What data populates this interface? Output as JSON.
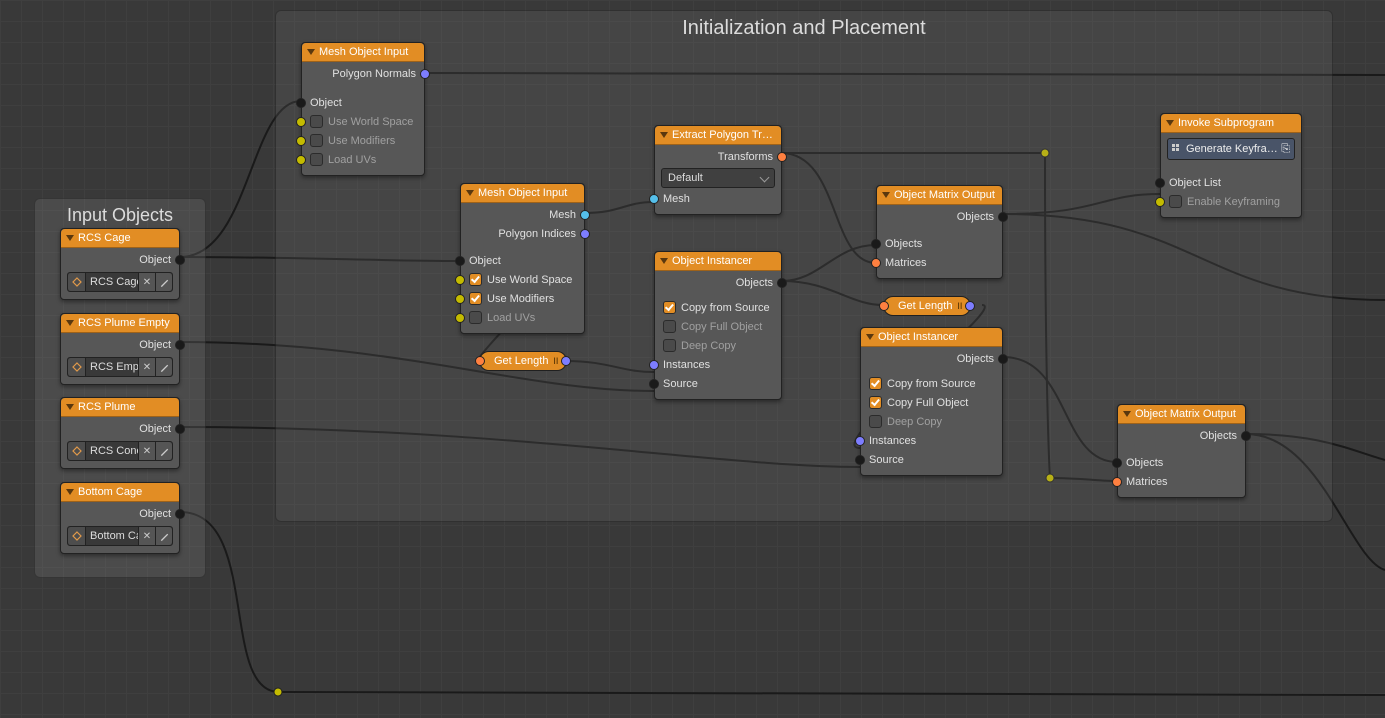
{
  "frames": {
    "input_objects": {
      "title": "Input Objects"
    },
    "main": {
      "title": "Initialization and Placement"
    }
  },
  "nodes": {
    "rcs_cage": {
      "title": "RCS Cage",
      "out": "Object",
      "obj": "RCS Cage"
    },
    "rcs_plume_empty": {
      "title": "RCS Plume Empty",
      "out": "Object",
      "obj": "RCS Empty"
    },
    "rcs_plume": {
      "title": "RCS Plume",
      "out": "Object",
      "obj": "RCS Cone"
    },
    "bottom_cage": {
      "title": "Bottom Cage",
      "out": "Object",
      "obj": "Bottom Ca"
    },
    "mesh_input_1": {
      "title": "Mesh Object Input",
      "out_normals": "Polygon Normals",
      "in_object": "Object",
      "use_world": "Use World Space",
      "use_mods": "Use Modifiers",
      "load_uvs": "Load UVs"
    },
    "mesh_input_2": {
      "title": "Mesh Object Input",
      "out_mesh": "Mesh",
      "out_indices": "Polygon Indices",
      "in_object": "Object",
      "use_world": "Use World Space",
      "use_mods": "Use Modifiers",
      "load_uvs": "Load UVs"
    },
    "extract_poly": {
      "title": "Extract Polygon Tr…",
      "out_transforms": "Transforms",
      "select_val": "Default",
      "in_mesh": "Mesh"
    },
    "instancer_1": {
      "title": "Object Instancer",
      "out_objects": "Objects",
      "copy_from_source": "Copy from Source",
      "copy_full": "Copy Full Object",
      "deep_copy": "Deep Copy",
      "in_instances": "Instances",
      "in_source": "Source"
    },
    "instancer_2": {
      "title": "Object Instancer",
      "out_objects": "Objects",
      "copy_from_source": "Copy from Source",
      "copy_full": "Copy Full Object",
      "deep_copy": "Deep Copy",
      "in_instances": "Instances",
      "in_source": "Source"
    },
    "matrix_out_1": {
      "title": "Object Matrix Output",
      "out_objects": "Objects",
      "in_objects": "Objects",
      "in_matrices": "Matrices"
    },
    "matrix_out_2": {
      "title": "Object Matrix Output",
      "out_objects": "Objects",
      "in_objects": "Objects",
      "in_matrices": "Matrices"
    },
    "invoke": {
      "title": "Invoke Subprogram",
      "subprog": "Generate Keyfra…",
      "in_list": "Object List",
      "enable_kf": "Enable Keyframing"
    },
    "get_length_1": {
      "label": "Get Length"
    },
    "get_length_2": {
      "label": "Get Length"
    }
  }
}
